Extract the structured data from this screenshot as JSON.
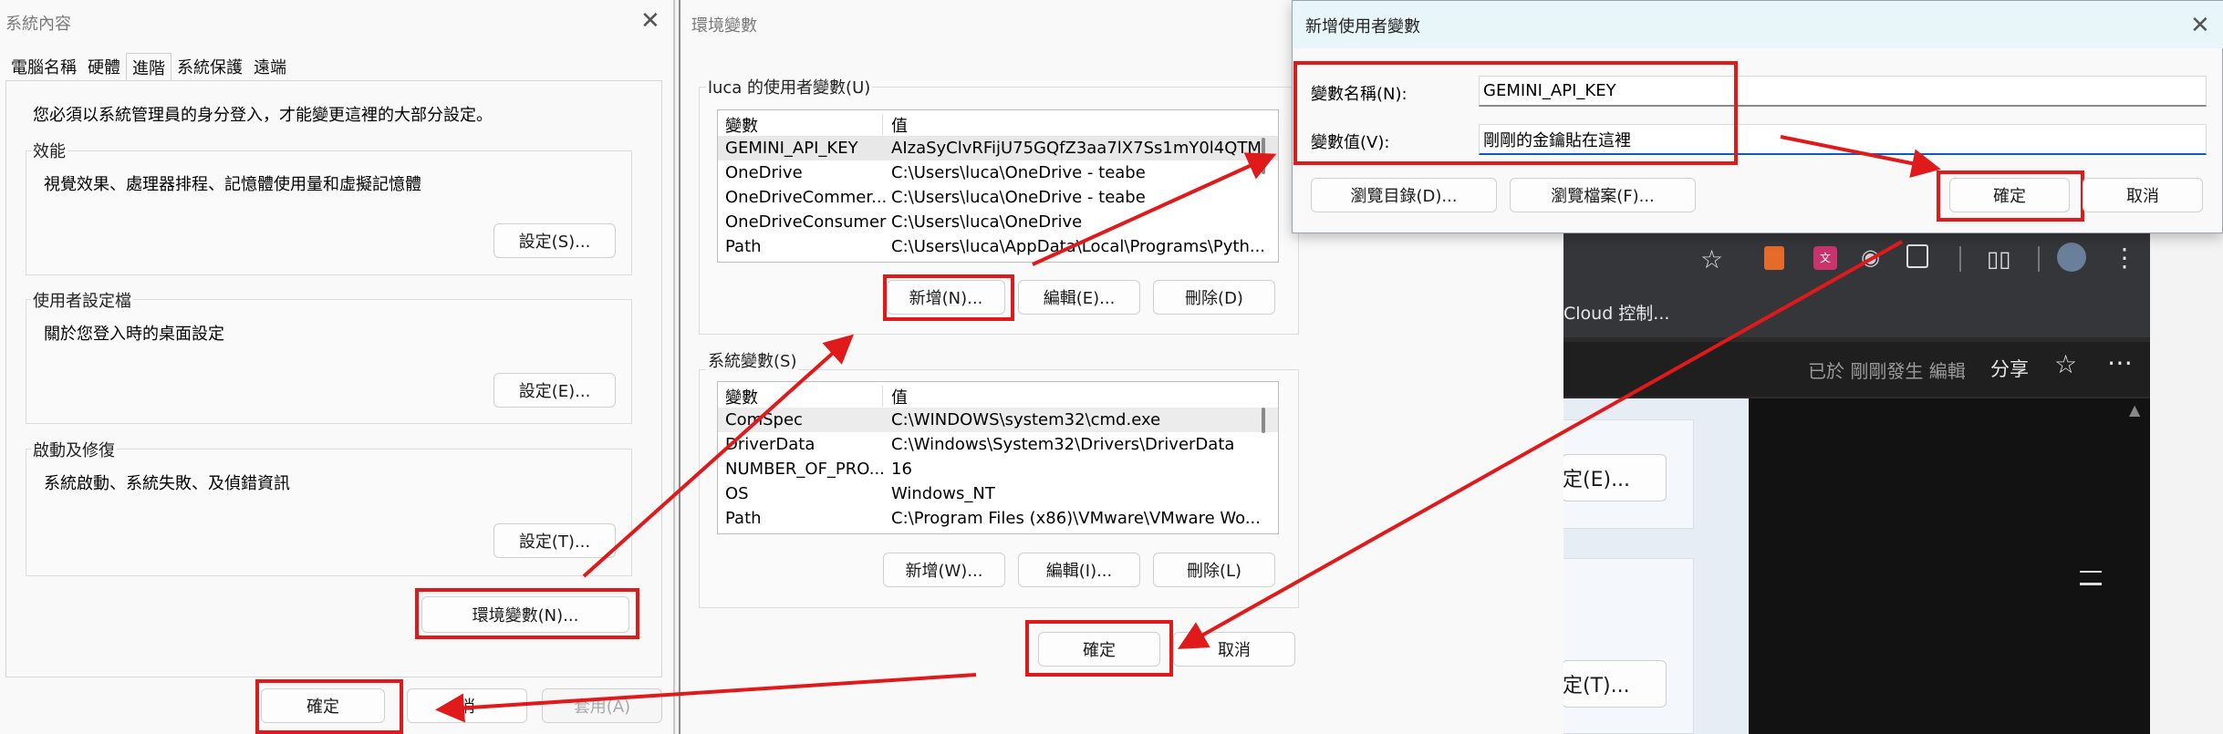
{
  "sys_props": {
    "title": "系統內容",
    "tabs": [
      "電腦名稱",
      "硬體",
      "進階",
      "系統保護",
      "遠端"
    ],
    "admin_note": "您必須以系統管理員的身分登入，才能變更這裡的大部分設定。",
    "performance": {
      "label": "效能",
      "desc": "視覺效果、處理器排程、記憶體使用量和虛擬記憶體",
      "button": "設定(S)..."
    },
    "user_profiles": {
      "label": "使用者設定檔",
      "desc": "關於您登入時的桌面設定",
      "button": "設定(E)..."
    },
    "startup": {
      "label": "啟動及修復",
      "desc": "系統啟動、系統失敗、及偵錯資訊",
      "button": "設定(T)..."
    },
    "env_button": "環境變數(N)...",
    "ok": "確定",
    "cancel_partial": "消",
    "apply": "套用(A)"
  },
  "env_vars": {
    "title": "環境變數",
    "user_section": "luca 的使用者變數(U)",
    "col_var": "變數",
    "col_val": "值",
    "user_rows": [
      {
        "name": "GEMINI_API_KEY",
        "value": "AIzaSyClvRFijU75GQfZ3aa7lX7Ss1mY0l4QTM"
      },
      {
        "name": "OneDrive",
        "value": "C:\\Users\\luca\\OneDrive - teabe"
      },
      {
        "name": "OneDriveCommer...",
        "value": "C:\\Users\\luca\\OneDrive - teabe"
      },
      {
        "name": "OneDriveConsumer",
        "value": "C:\\Users\\luca\\OneDrive"
      },
      {
        "name": "Path",
        "value": "C:\\Users\\luca\\AppData\\Local\\Programs\\Pyth..."
      }
    ],
    "user_buttons": {
      "new": "新增(N)...",
      "edit": "編輯(E)...",
      "delete": "刪除(D)"
    },
    "system_section": "系統變數(S)",
    "system_rows": [
      {
        "name": "ComSpec",
        "value": "C:\\WINDOWS\\system32\\cmd.exe"
      },
      {
        "name": "DriverData",
        "value": "C:\\Windows\\System32\\Drivers\\DriverData"
      },
      {
        "name": "NUMBER_OF_PRO...",
        "value": "16"
      },
      {
        "name": "OS",
        "value": "Windows_NT"
      },
      {
        "name": "Path",
        "value": "C:\\Program Files (x86)\\VMware\\VMware Wo..."
      }
    ],
    "system_buttons": {
      "new": "新增(W)...",
      "edit": "編輯(I)...",
      "delete": "刪除(L)"
    },
    "ok": "確定",
    "cancel": "取消"
  },
  "new_var": {
    "title": "新增使用者變數",
    "name_label": "變數名稱(N):",
    "name_value": "GEMINI_API_KEY",
    "value_label": "變數值(V):",
    "value_value": "剛剛的金鑰貼在這裡",
    "browse_dir": "瀏覽目錄(D)...",
    "browse_file": "瀏覽檔案(F)...",
    "ok": "確定",
    "cancel": "取消"
  },
  "background": {
    "menu_text": "Cloud 控制...",
    "status_text": "已於 剛剛發生 編輯",
    "share": "分享",
    "btn_e": "定(E)...",
    "btn_t": "定(T)..."
  },
  "colors": {
    "highlight_red": "#e0191a",
    "dark_bg": "#202124",
    "focus_blue": "#0a5cc2"
  },
  "icons": [
    "star-icon",
    "bookmark-arrow-icon",
    "translate-icon",
    "camera-icon",
    "extension-icon",
    "reader-icon",
    "profile-avatar-icon",
    "more-vert-icon",
    "more-horiz-icon",
    "scroll-up-icon",
    "close-icon"
  ]
}
